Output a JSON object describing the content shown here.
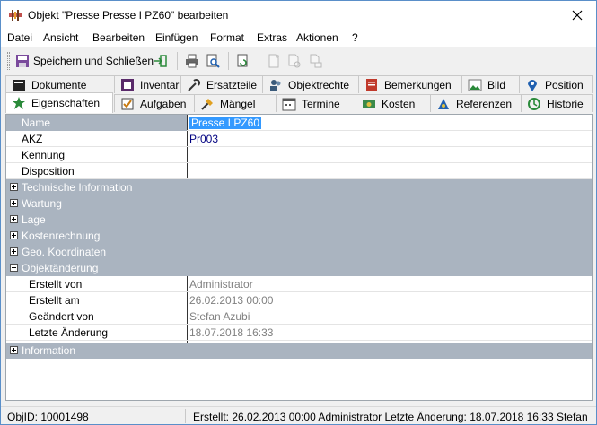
{
  "window": {
    "title": "Objekt \"Presse Presse I PZ60\" bearbeiten"
  },
  "menu": [
    "Datei",
    "Ansicht",
    "Bearbeiten",
    "Einfügen",
    "Format",
    "Extras",
    "Aktionen",
    "?"
  ],
  "toolbar": {
    "save_close_label": "Speichern und Schließen"
  },
  "tabs_back": [
    "Dokumente",
    "Inventar",
    "Ersatzteile",
    "Objektrechte",
    "Bemerkungen",
    "Bild",
    "Position"
  ],
  "tabs_front": [
    "Eigenschaften",
    "Aufgaben",
    "Mängel",
    "Termine",
    "Kosten",
    "Referenzen",
    "Historie"
  ],
  "active_tab": "Eigenschaften",
  "properties": {
    "name": {
      "label": "Name",
      "value": "Presse I PZ60"
    },
    "akz": {
      "label": "AKZ",
      "value": "Pr003"
    },
    "kennung": {
      "label": "Kennung",
      "value": ""
    },
    "disposition": {
      "label": "Disposition",
      "value": ""
    },
    "categories": [
      "Technische Information",
      "Wartung",
      "Lage",
      "Kostenrechnung",
      "Geo. Koordinaten"
    ],
    "objektaenderung": {
      "label": "Objektänderung",
      "rows": [
        {
          "label": "Erstellt von",
          "value": "Administrator"
        },
        {
          "label": "Erstellt am",
          "value": "26.02.2013 00:00"
        },
        {
          "label": "Geändert von",
          "value": "Stefan Azubi"
        },
        {
          "label": "Letzte Änderung",
          "value": "18.07.2018 16:33"
        }
      ]
    },
    "information": {
      "label": "Information"
    }
  },
  "status": {
    "objid": "ObjID: 10001498",
    "summary": "Erstellt: 26.02.2013 00:00 Administrator  Letzte Änderung: 18.07.2018 16:33 Stefan Azubi"
  }
}
